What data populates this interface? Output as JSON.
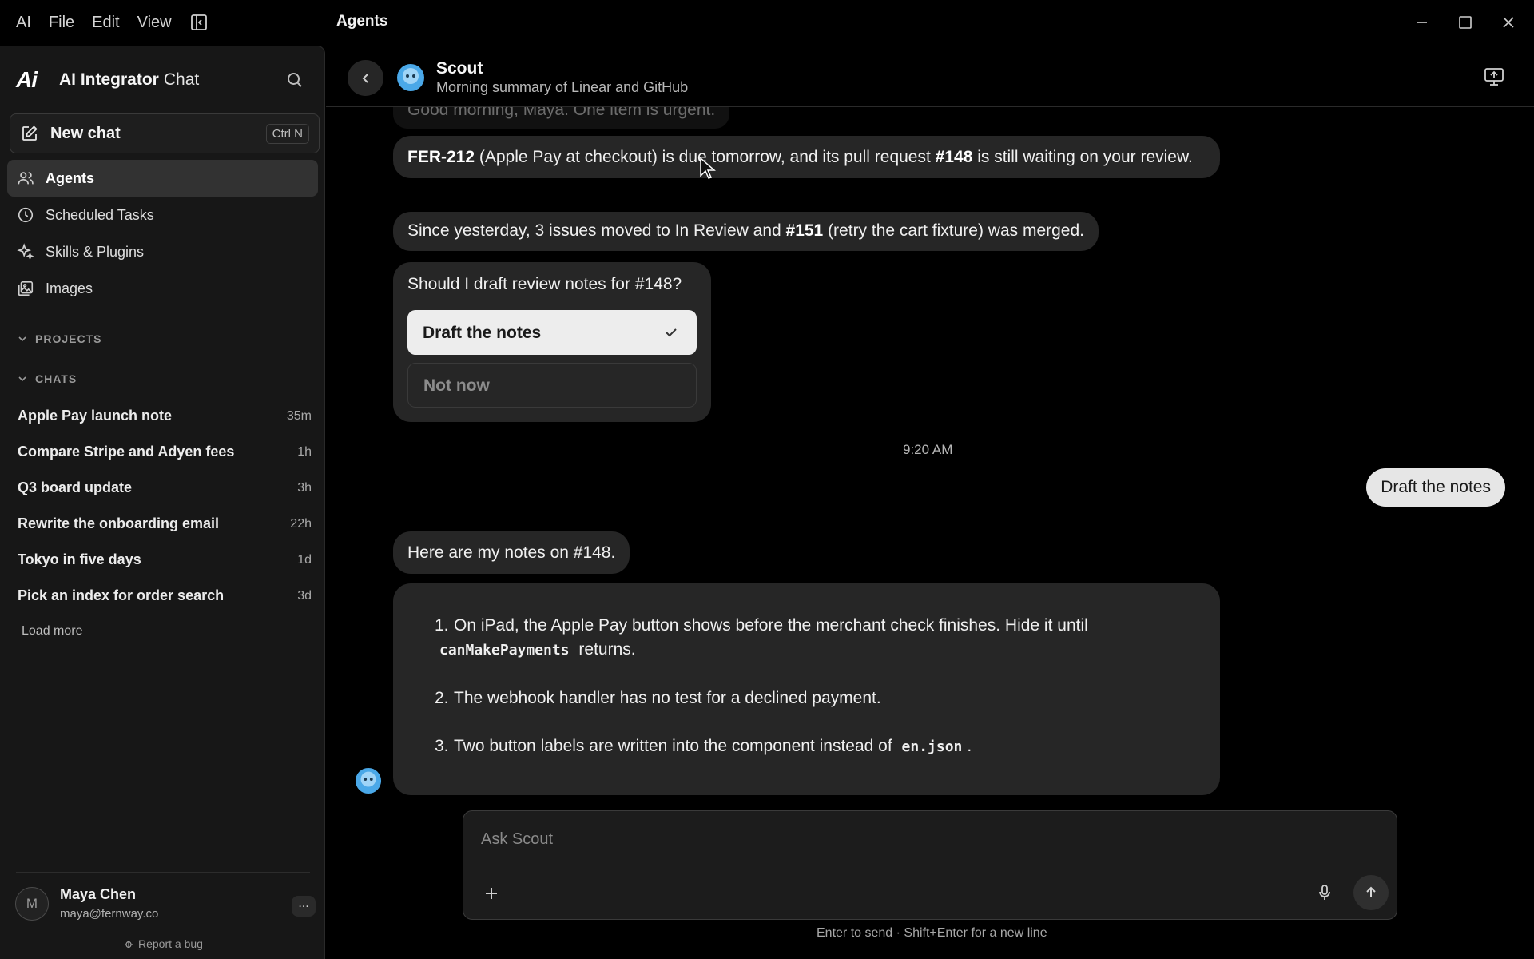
{
  "menubar": {
    "items": [
      "AI",
      "File",
      "Edit",
      "View"
    ]
  },
  "window": {
    "title": "Agents"
  },
  "sidebar": {
    "brand": {
      "logo": "Ai",
      "name": "AI Integrator",
      "suffix": "Chat"
    },
    "new_chat": {
      "label": "New chat",
      "shortcut": "Ctrl N"
    },
    "nav": [
      {
        "label": "Agents",
        "icon": "users-icon",
        "active": true
      },
      {
        "label": "Scheduled Tasks",
        "icon": "clock-icon",
        "active": false
      },
      {
        "label": "Skills & Plugins",
        "icon": "sparkle-icon",
        "active": false
      },
      {
        "label": "Images",
        "icon": "image-icon",
        "active": false
      }
    ],
    "sections": {
      "projects": "PROJECTS",
      "chats": "CHATS"
    },
    "chats": [
      {
        "title": "Apple Pay launch note",
        "time": "35m"
      },
      {
        "title": "Compare Stripe and Adyen fees",
        "time": "1h"
      },
      {
        "title": "Q3 board update",
        "time": "3h"
      },
      {
        "title": "Rewrite the onboarding email",
        "time": "22h"
      },
      {
        "title": "Tokyo in five days",
        "time": "1d"
      },
      {
        "title": "Pick an index for order search",
        "time": "3d"
      }
    ],
    "load_more": "Load more",
    "user": {
      "initial": "M",
      "name": "Maya Chen",
      "email": "maya@fernway.co",
      "more": "..."
    },
    "report_bug": "Report a bug"
  },
  "agent": {
    "name": "Scout",
    "description": "Morning summary of Linear and GitHub"
  },
  "messages": {
    "greeting": "Good morning, Maya. One item is urgent.",
    "urgent": {
      "issue": "FER-212",
      "mid": " (Apple Pay at checkout) is due tomorrow, and its pull request ",
      "pr": "#148",
      "end": " is still waiting on your review."
    },
    "since": {
      "start": "Since yesterday, 3 issues moved to In Review and ",
      "pr": "#151",
      "end": " (retry the cart fixture) was merged."
    },
    "question": "Should I draft review notes for #148?",
    "options": [
      "Draft the notes",
      "Not now"
    ],
    "timestamp": "9:20 AM",
    "user_reply": "Draft the notes",
    "notes_intro": "Here are my notes on #148.",
    "notes": [
      {
        "n": "1.",
        "a": "On iPad, the Apple Pay button shows before the merchant check finishes. Hide it until ",
        "code": "canMakePayments",
        "b": " returns."
      },
      {
        "n": "2.",
        "a": "The webhook handler has no test for a declined payment.",
        "code": "",
        "b": ""
      },
      {
        "n": "3.",
        "a": "Two button labels are written into the component instead of ",
        "code": "en.json",
        "b": "."
      }
    ]
  },
  "composer": {
    "placeholder": "Ask Scout",
    "hint": "Enter to send · Shift+Enter for a new line"
  },
  "colors": {
    "background": "#000000",
    "sidebar": "#171717",
    "bubble": "#262626",
    "user_bubble": "#e6e6e6",
    "avatar_blue": "#4aa8e8"
  }
}
